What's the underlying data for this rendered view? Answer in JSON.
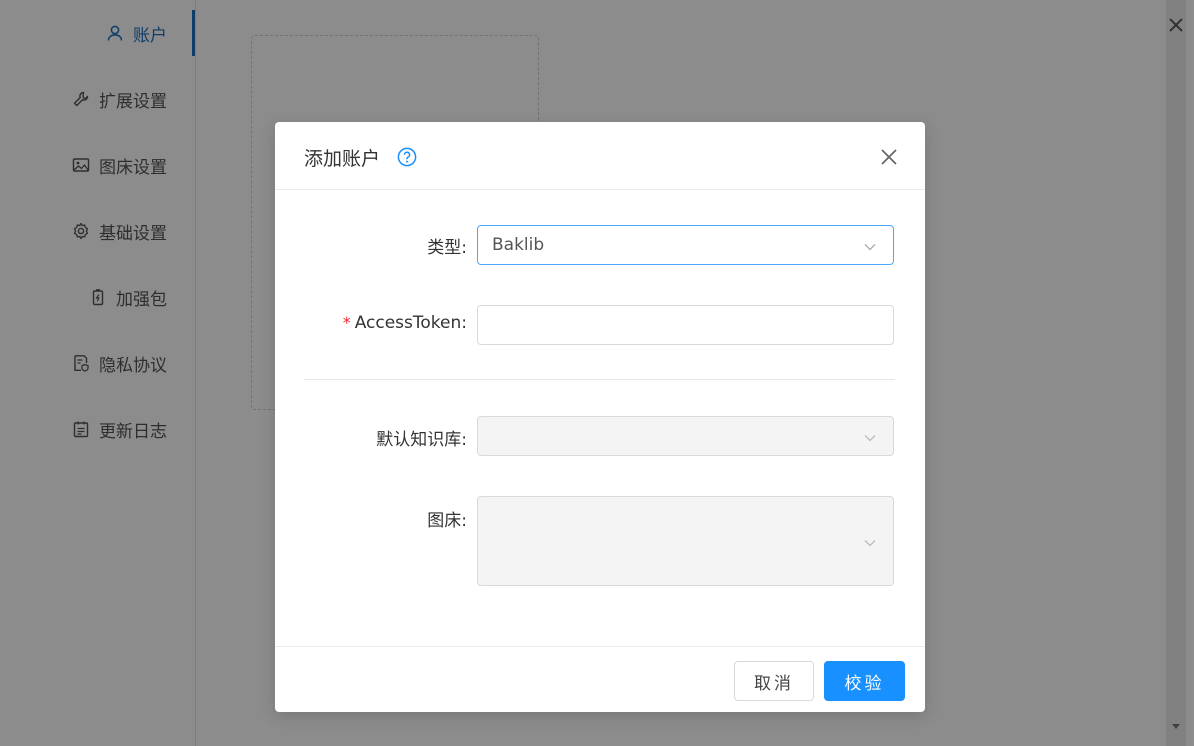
{
  "sidebar": {
    "items": [
      {
        "label": "账户",
        "icon": "user-icon",
        "active": true
      },
      {
        "label": "扩展设置",
        "icon": "wrench-icon"
      },
      {
        "label": "图床设置",
        "icon": "image-icon"
      },
      {
        "label": "基础设置",
        "icon": "gear-icon"
      },
      {
        "label": "加强包",
        "icon": "battery-icon"
      },
      {
        "label": "隐私协议",
        "icon": "privacy-document-icon"
      },
      {
        "label": "更新日志",
        "icon": "calendar-icon"
      }
    ]
  },
  "modal": {
    "title": "添加账户",
    "help_icon": "question-circle-icon",
    "close_icon": "close-icon",
    "fields": {
      "type": {
        "label": "类型:",
        "value": "Baklib"
      },
      "access_token": {
        "label": "AccessToken:",
        "required_mark": "*",
        "value": "",
        "placeholder": ""
      },
      "default_kb": {
        "label": "默认知识库:",
        "value": ""
      },
      "image_host": {
        "label": "图床:",
        "value": ""
      }
    },
    "buttons": {
      "cancel": "取消",
      "verify": "校验"
    }
  },
  "colors": {
    "accent": "#1890ff",
    "sidebar_active": "#1b6fc2",
    "required": "#f5222d",
    "overlay": "rgba(0,0,0,0.45)"
  }
}
